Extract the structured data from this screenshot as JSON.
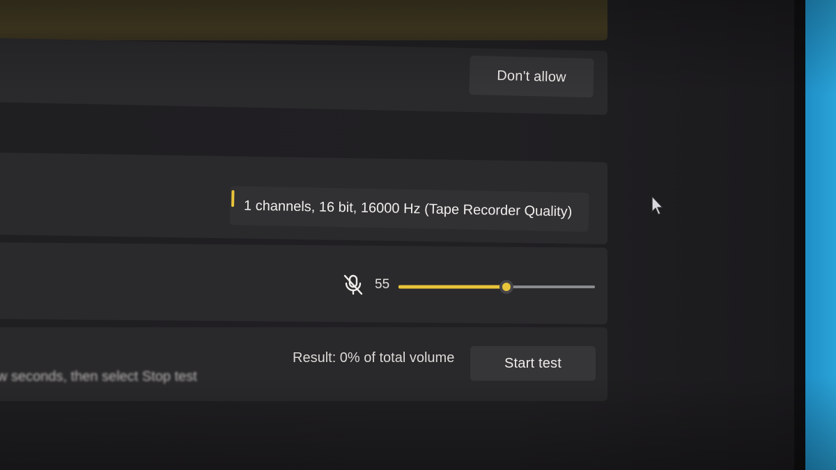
{
  "permission": {
    "dont_allow_label": "Don't allow"
  },
  "format": {
    "selected_value": "1 channels, 16 bit, 16000 Hz (Tape Recorder Quality)"
  },
  "input_volume": {
    "icon": "microphone-muted-icon",
    "value": "55",
    "level": 0.55
  },
  "mic_test": {
    "result_text": "Result: 0% of total volume",
    "start_label": "Start test",
    "instruction_text": "w seconds, then select Stop test"
  },
  "colors": {
    "accent": "#e8c43a",
    "track": "#8a8b8f",
    "background": "#1f1e21",
    "card": "#2a292c",
    "desk_blue": "#2aa3d8"
  }
}
